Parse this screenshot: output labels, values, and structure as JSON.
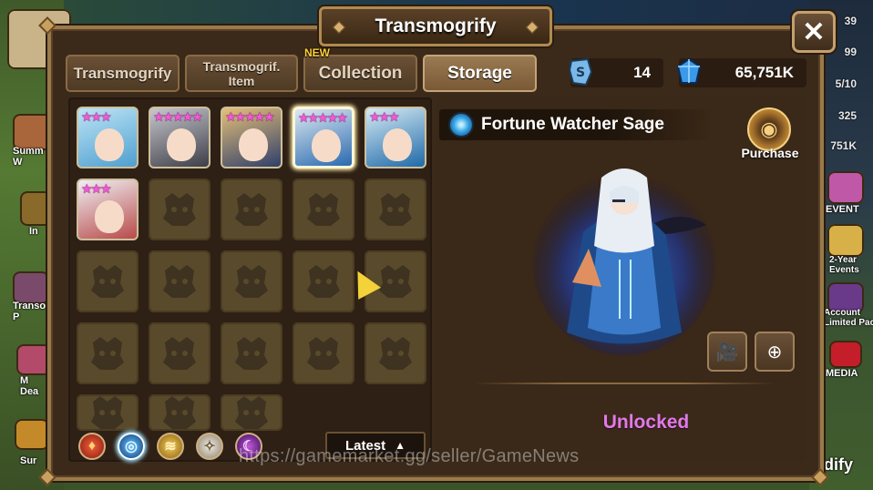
{
  "window": {
    "title": "Transmogrify"
  },
  "tabs": [
    {
      "label": "Transmogrify",
      "active": false
    },
    {
      "label": "Transmogrif.\nItem",
      "active": false
    },
    {
      "label": "Collection",
      "active": false,
      "badge": "NEW"
    },
    {
      "label": "Storage",
      "active": true
    }
  ],
  "currency": {
    "transmog_stones": "14",
    "crystals": "65,751K"
  },
  "grid": {
    "monsters": [
      {
        "stars": 3,
        "name": "water-fairy",
        "colors": [
          "#bde4f5",
          "#4f9fd0"
        ]
      },
      {
        "stars": 5,
        "name": "dark-knight",
        "colors": [
          "#c7c7cd",
          "#3d3e48"
        ]
      },
      {
        "stars": 5,
        "name": "blonde-warrior",
        "colors": [
          "#e6c078",
          "#2f3f6a"
        ]
      },
      {
        "stars": 5,
        "name": "fortune-watcher-sage",
        "colors": [
          "#dde8f0",
          "#2a6ab0"
        ]
      },
      {
        "stars": 3,
        "name": "wind-elf",
        "colors": [
          "#d6eaf4",
          "#1f6aa8"
        ]
      },
      {
        "stars": 3,
        "name": "snow-vampire",
        "colors": [
          "#f0f0f4",
          "#b84a4a"
        ]
      }
    ],
    "empty_slots": 17
  },
  "filters": [
    {
      "name": "fire-filter",
      "color": "#c42a20"
    },
    {
      "name": "water-filter",
      "color": "#1a6ab8",
      "active": true
    },
    {
      "name": "wind-filter",
      "color": "#d6a020"
    },
    {
      "name": "light-filter",
      "color": "#cfc8b8"
    },
    {
      "name": "dark-filter",
      "color": "#8a2a9a"
    }
  ],
  "sort": {
    "label": "Latest"
  },
  "detail": {
    "name": "Fortune Watcher Sage",
    "purchase_label": "Purchase",
    "status": "Unlocked"
  },
  "side_left": [
    "Summ\nW",
    "In",
    "Transo\nP",
    "M\nDea",
    "Sur"
  ],
  "side_right": {
    "values": [
      "39",
      "99",
      "5/10",
      "325",
      "751K"
    ],
    "labels": [
      "EVENT",
      "2-Year\nEvents",
      "Account\nLimited Pack",
      "MEDIA",
      "dify"
    ]
  },
  "watermark": "https://gamemarket.gg/seller/GameNews"
}
